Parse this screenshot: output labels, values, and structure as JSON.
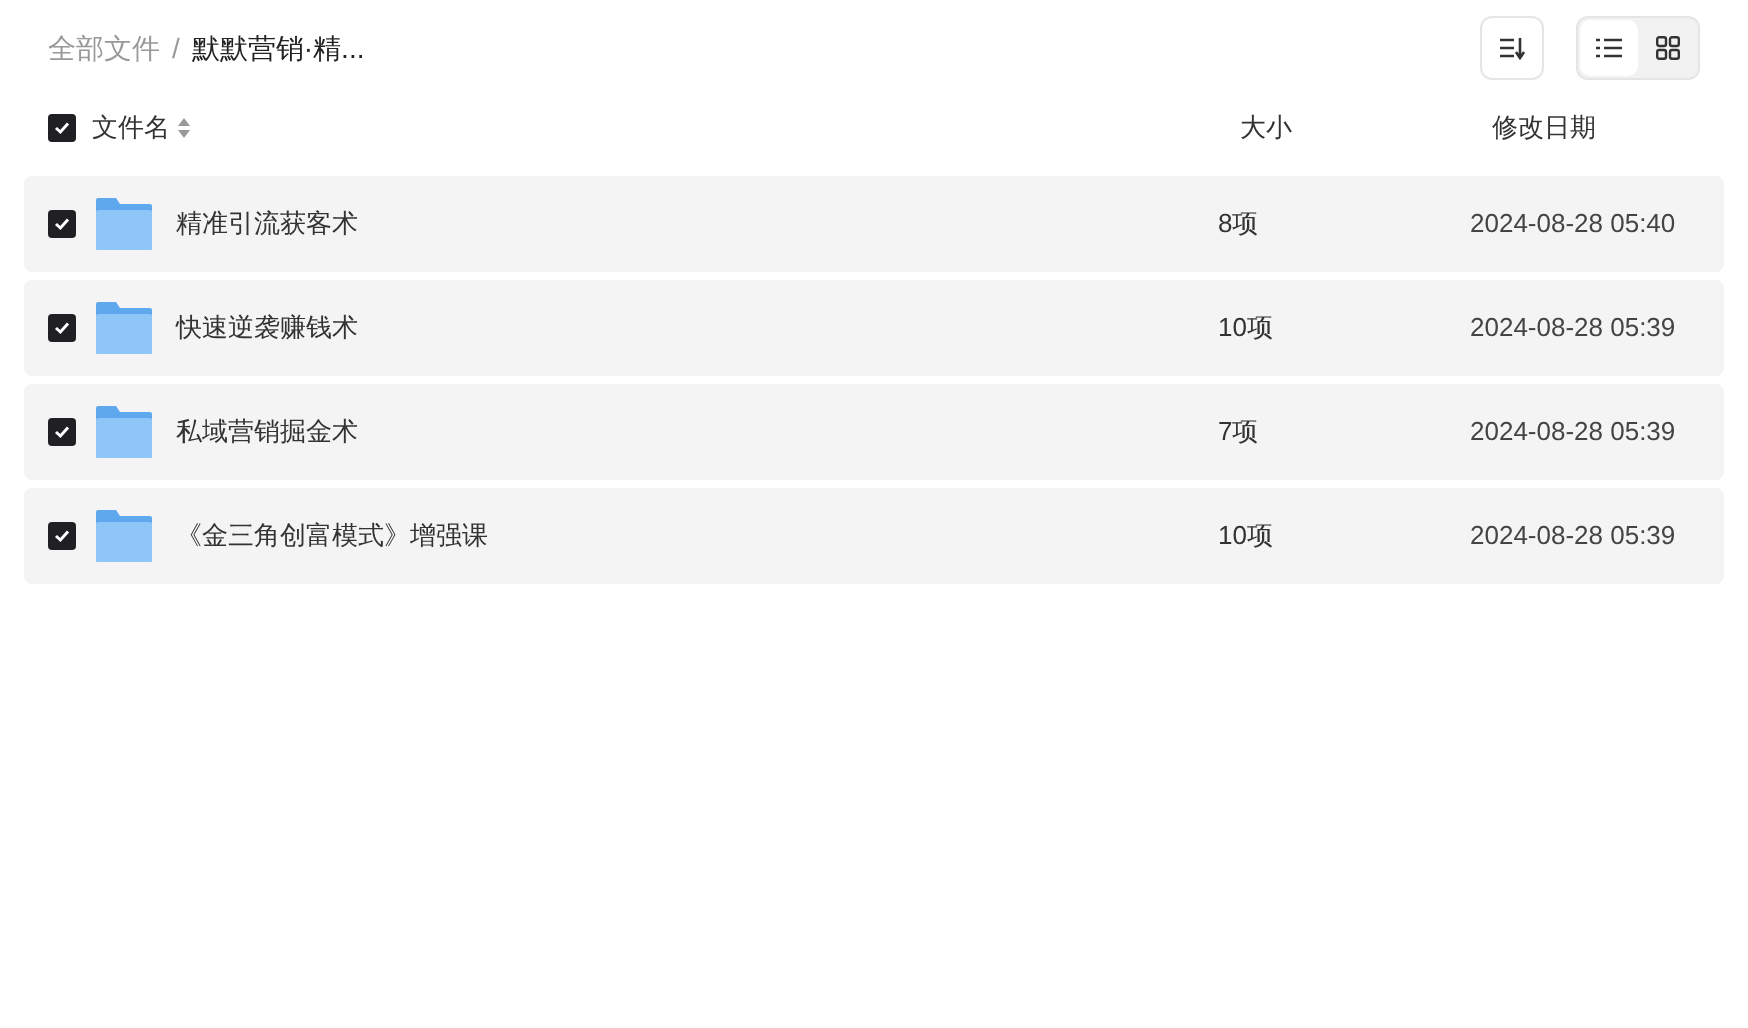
{
  "breadcrumb": [
    {
      "label": "全部文件",
      "current": false
    },
    {
      "label": "默默营销·精...",
      "current": true
    }
  ],
  "breadcrumb_separator": "/",
  "view_toggle": [
    {
      "kind": "list",
      "selected": true
    },
    {
      "kind": "grid",
      "selected": false
    }
  ],
  "table": {
    "select_all_checked": true,
    "columns": [
      "文件名",
      "大小",
      "修改日期"
    ],
    "rows": [
      {
        "name": "精准引流获客术",
        "size": "8项",
        "modified": "2024-08-28 05:40",
        "checked": true
      },
      {
        "name": "快速逆袭赚钱术",
        "size": "10项",
        "modified": "2024-08-28 05:39",
        "checked": true
      },
      {
        "name": "私域营销掘金术",
        "size": "7项",
        "modified": "2024-08-28 05:39",
        "checked": true
      },
      {
        "name": "《金三角创富模式》增强课",
        "size": "10项",
        "modified": "2024-08-28 05:39",
        "checked": true
      }
    ]
  }
}
